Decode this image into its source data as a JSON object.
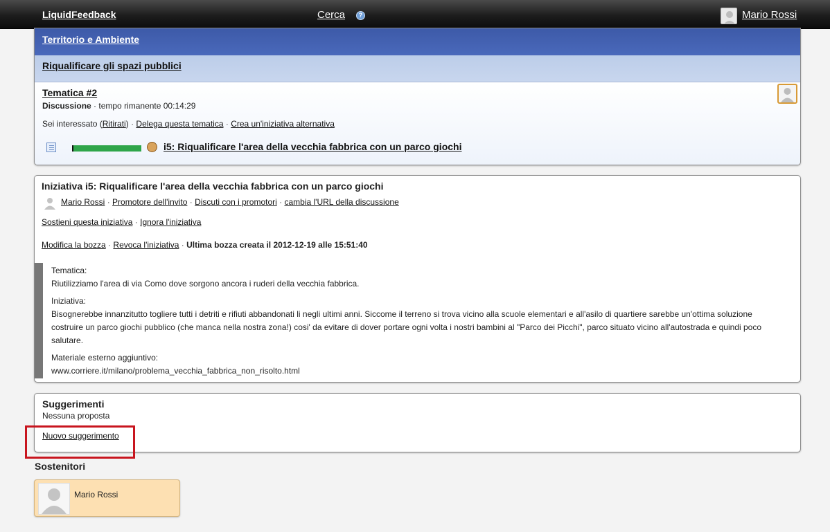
{
  "topbar": {
    "brand": "LiquidFeedback",
    "search": "Cerca",
    "help_glyph": "?",
    "user_name": "Mario Rossi"
  },
  "issue": {
    "area": "Territorio e Ambiente",
    "policy": "Riqualificare gli spazi pubblici",
    "title": "Tematica #2",
    "status_label": "Discussione",
    "status_time": "· tempo rimanente 00:14:29",
    "interest_prefix": "Sei interessato (",
    "withdraw": "Ritirati",
    "interest_suffix": ")",
    "delegate": "Delega questa tematica",
    "alternative": "Crea un'iniziativa alternativa",
    "initiative_link": "i5: Riqualificare l'area della vecchia fabbrica con un parco giochi"
  },
  "initiative": {
    "title": "Iniziativa i5: Riqualificare l'area della vecchia fabbrica con un parco giochi",
    "author": "Mario Rossi",
    "promoter": "Promotore dell'invito",
    "discuss": "Discuti con i promotori",
    "change_url": "cambia l'URL della discussione",
    "support": "Sostieni questa iniziativa",
    "ignore": "Ignora l'iniziativa",
    "edit_draft": "Modifica la bozza",
    "revoke": "Revoca l'iniziativa",
    "last_draft": "Ultima bozza creata il 2012-12-19 alle 15:51:40",
    "content": {
      "issue_label": "Tematica:",
      "issue_text": "Riutilizziamo l'area di via Como dove sorgono ancora i ruderi della vecchia fabbrica.",
      "initiative_label": "Iniziativa:",
      "initiative_text": "Bisognerebbe innanzitutto togliere tutti i detriti e rifiuti abbandonati li negli ultimi anni. Siccome il terreno si trova vicino alla scuole elementari e all'asilo di quartiere sarebbe un'ottima soluzione costruire un parco giochi pubblico (che manca nella nostra zona!) cosi' da evitare di dover portare ogni volta i nostri bambini al \"Parco dei Picchi\", parco situato vicino all'autostrada e quindi poco salutare.",
      "external_label": "Materiale esterno aggiuntivo:",
      "external_url": "www.corriere.it/milano/problema_vecchia_fabbrica_non_risolto.html"
    }
  },
  "suggestions": {
    "title": "Suggerimenti",
    "none": "Nessuna proposta",
    "new": "Nuovo suggerimento"
  },
  "supporters": {
    "title": "Sostenitori",
    "items": [
      {
        "name": "Mario Rossi"
      }
    ]
  },
  "colors": {
    "area_bar": "#4463b4",
    "policy_bar": "#c2d2ec",
    "progress": "#2fa54a",
    "highlight": "#c8151e",
    "supporter_card": "#fde0b2"
  },
  "icons": [
    "help-icon",
    "user-avatar-icon",
    "document-icon",
    "progress-bar",
    "initiator-hat-icon"
  ]
}
